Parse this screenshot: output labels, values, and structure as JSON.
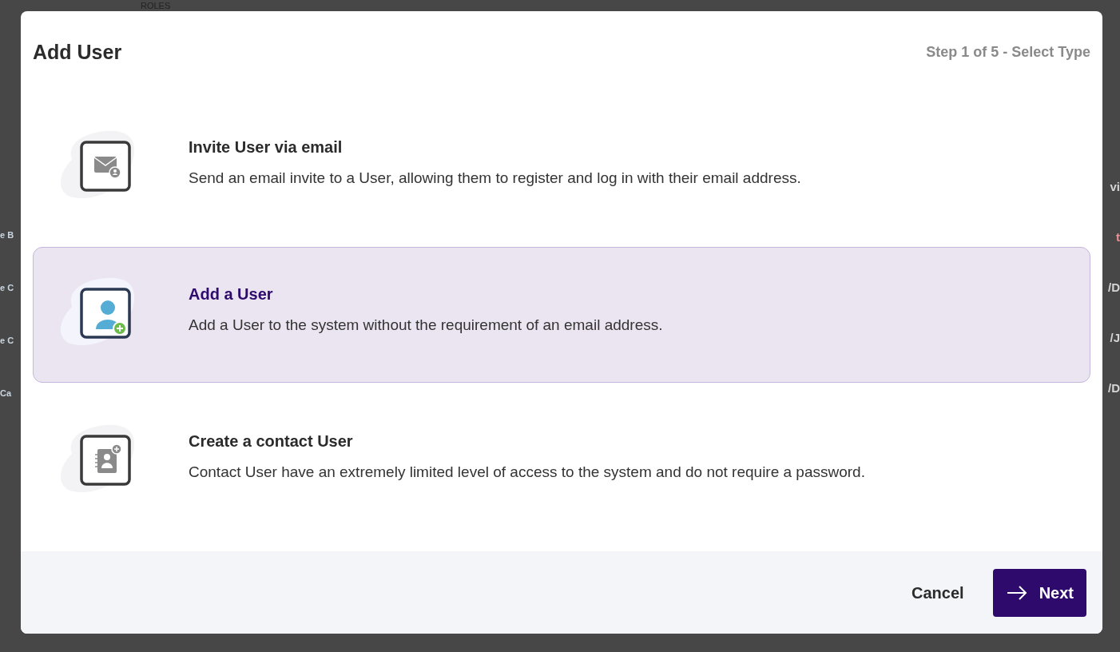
{
  "background": {
    "column_header": "ROLES",
    "left_fragments": [
      "e B",
      "e C",
      "e C",
      "Ca"
    ],
    "right_fragments": [
      {
        "text": "vi",
        "color": "#d4d4d4"
      },
      {
        "text": "t",
        "color": "#f09090"
      },
      {
        "text": "/D",
        "color": "#d4d4d4"
      },
      {
        "text": "/J",
        "color": "#d4d4d4"
      },
      {
        "text": "/D",
        "color": "#d4d4d4"
      }
    ]
  },
  "dialog": {
    "title": "Add User",
    "step": "Step 1 of 5 - Select Type",
    "options": [
      {
        "kind": "email",
        "title": "Invite User via email",
        "description": "Send an email invite to a User, allowing them to register and log in with their email address.",
        "selected": false
      },
      {
        "kind": "user",
        "title": "Add a User",
        "description": "Add a User to the system without the requirement of an email address.",
        "selected": true
      },
      {
        "kind": "contact",
        "title": "Create a contact User",
        "description": "Contact User have an extremely limited level of access to the system and do not require a password.",
        "selected": false
      }
    ],
    "buttons": {
      "cancel": "Cancel",
      "next": "Next"
    }
  }
}
